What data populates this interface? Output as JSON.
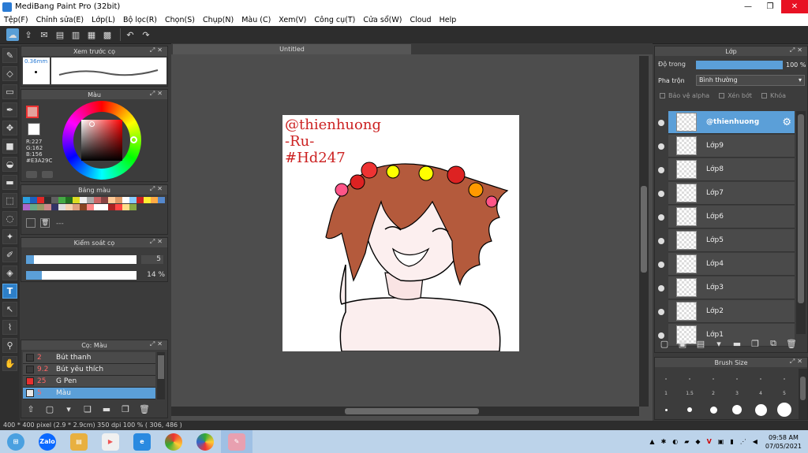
{
  "window": {
    "title": "MediBang Paint Pro (32bit)"
  },
  "menu": [
    "Tệp(F)",
    "Chỉnh sửa(E)",
    "Lớp(L)",
    "Bộ lọc(R)",
    "Chọn(S)",
    "Chụp(N)",
    "Màu (C)",
    "Xem(V)",
    "Công cụ(T)",
    "Cửa sổ(W)",
    "Cloud",
    "Help"
  ],
  "panels": {
    "brush_preview": {
      "title": "Xem trước cọ",
      "size": "0.36mm"
    },
    "color": {
      "title": "Màu",
      "r": "R:227",
      "g": "G:162",
      "b": "B:156",
      "hex": "#E3A29C"
    },
    "palette": {
      "title": "Bảng màu",
      "empty": "---"
    },
    "brush_control": {
      "title": "Kiểm soát cọ",
      "size_value": "5",
      "opacity_value": "14 %",
      "size_fraction": 0.07,
      "opacity_fraction": 0.14
    },
    "brush": {
      "title": "Cọ: Màu",
      "items": [
        {
          "size": "2",
          "name": "Bút thanh",
          "color": "#3a3a3a"
        },
        {
          "size": "9.2",
          "name": "Bút yêu thích",
          "color": "#3a3a3a"
        },
        {
          "size": "25",
          "name": "G Pen",
          "color": "#e83030"
        },
        {
          "size": "5",
          "name": "Màu",
          "color": "#e8e8e8",
          "selected": true
        }
      ]
    },
    "layers": {
      "title": "Lớp",
      "opacity_label": "Độ trong",
      "opacity_value": "100 %",
      "blend_label": "Pha trộn",
      "blend_value": "Bình thường",
      "protect_alpha": "Bảo vệ alpha",
      "clipping": "Xén bớt",
      "lock": "Khóa",
      "items": [
        "@thienhuong",
        "Lớp9",
        "Lớp8",
        "Lớp7",
        "Lớp6",
        "Lớp5",
        "Lớp4",
        "Lớp3",
        "Lớp2",
        "Lớp1"
      ]
    },
    "brush_size": {
      "title": "Brush Size",
      "sizes": [
        "1",
        "1.5",
        "2",
        "3",
        "4",
        "5"
      ]
    }
  },
  "canvas": {
    "tab_title": "Untitled",
    "watermark_lines": [
      "@thienhuong",
      "-Ru-",
      "#Hd247"
    ]
  },
  "status": {
    "text": "400 * 400 pixel   (2.9 * 2.9cm)   350 dpi   100 %   ( 306, 486 )"
  },
  "taskbar": {
    "time": "09:58 AM",
    "date": "07/05/2021",
    "zalo": "Zalo"
  },
  "colors": {
    "accent": "#5b9fd8",
    "selected_tool": "#2d7fc8",
    "fg_color": "#E3A29C"
  },
  "palette_colors": [
    "#2aa0e0",
    "#1d60c0",
    "#e02828",
    "#303030",
    "#606060",
    "#44aa44",
    "#207020",
    "#dddd22",
    "#f0f0f0",
    "#aaaaaa",
    "#cc6666",
    "#884444",
    "#ffcc99",
    "#dd9966",
    "#ffffff",
    "#88ccff",
    "#cc2222",
    "#ffee33",
    "#ffaa44",
    "#5588cc",
    "#aa66cc",
    "#66aa88",
    "#999966",
    "#cc8888",
    "#333366",
    "#dddddd",
    "#f5d0b0",
    "#e0a080",
    "#884422",
    "#ff8888",
    "#ffffff",
    "#ffffff",
    "#aa2222",
    "#ff4444",
    "#ffdd88",
    "#88aa44"
  ]
}
